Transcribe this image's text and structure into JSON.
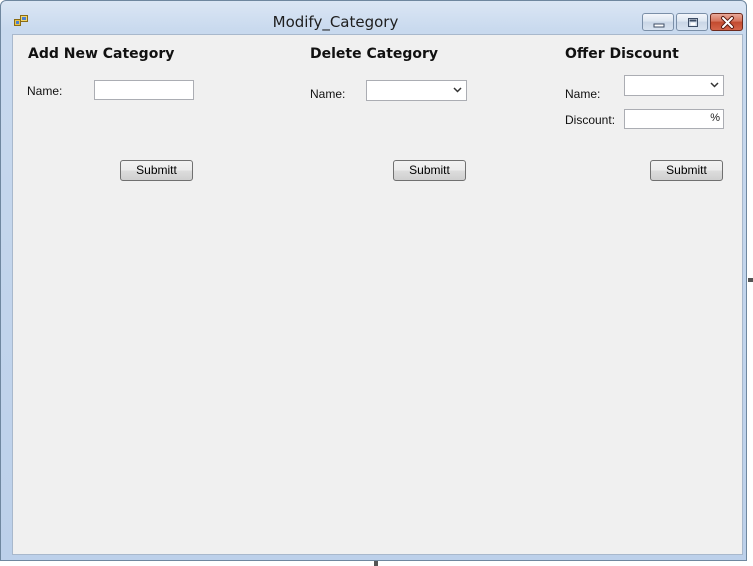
{
  "window": {
    "title": "Modify_Category",
    "icon": "app-icon",
    "controls": {
      "minimize": "minimize-icon",
      "maximize": "restore-icon",
      "close": "close-icon"
    }
  },
  "add_section": {
    "heading": "Add New Category",
    "name_label": "Name:",
    "name_value": "",
    "submit_label": "Submitt"
  },
  "delete_section": {
    "heading": "Delete Category",
    "name_label": "Name:",
    "selected": "",
    "submit_label": "Submitt"
  },
  "discount_section": {
    "heading": "Offer Discount",
    "name_label": "Name:",
    "selected": "",
    "discount_label": "Discount:",
    "discount_value": "",
    "discount_suffix": "%",
    "submit_label": "Submitt"
  },
  "colors": {
    "client_background": "#f0f0f0",
    "titlebar": "#c8d9ee",
    "close_button": "#c24a2f"
  }
}
